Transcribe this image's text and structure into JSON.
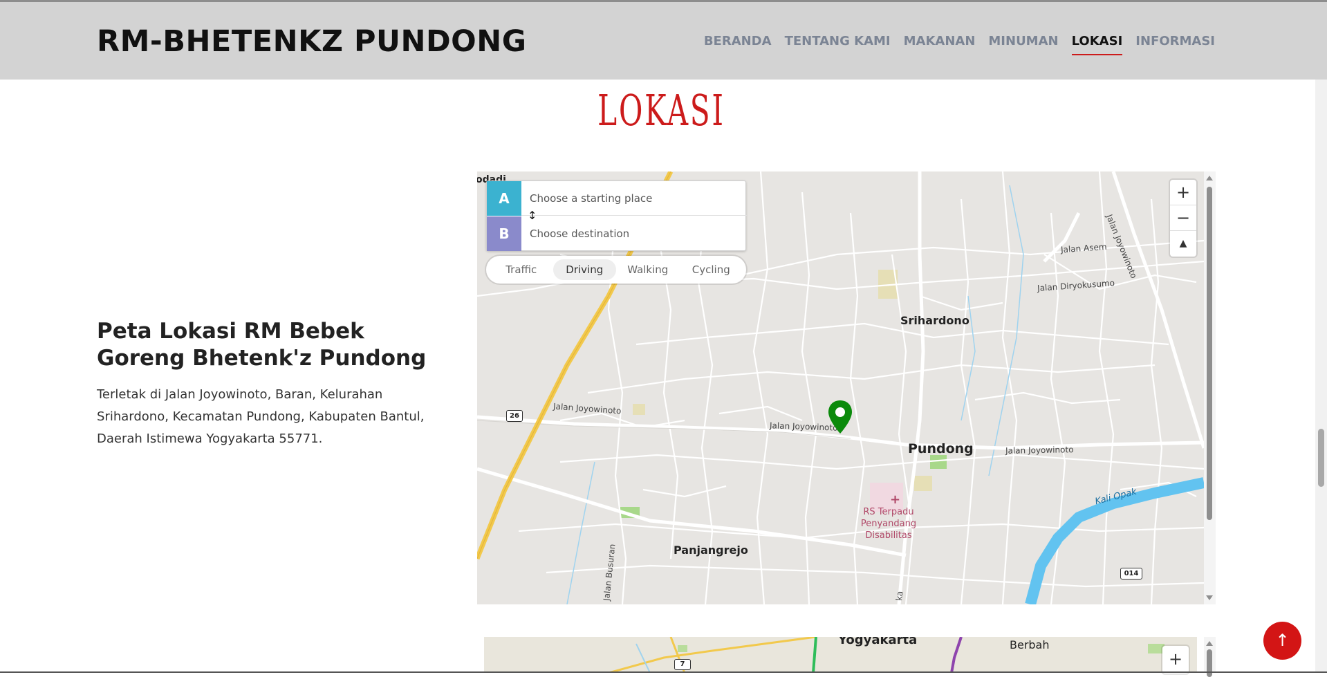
{
  "header": {
    "brand": "RM-BHETENKZ PUNDONG",
    "nav": [
      {
        "label": "BERANDA",
        "active": false
      },
      {
        "label": "TENTANG KAMI",
        "active": false
      },
      {
        "label": "MAKANAN",
        "active": false
      },
      {
        "label": "MINUMAN",
        "active": false
      },
      {
        "label": "LOKASI",
        "active": true
      },
      {
        "label": "INFORMASI",
        "active": false
      }
    ]
  },
  "section": {
    "title": "LOKASI"
  },
  "location": {
    "heading": "Peta Lokasi RM Bebek Goreng Bhetenk'z Pundong",
    "description": "Terletak di Jalan Joyowinoto, Baran, Kelurahan Srihardono, Kecamatan Pundong, Kabupaten Bantul, Daerah Istimewa Yogyakarta 55771."
  },
  "directions": {
    "a_label": "A",
    "b_label": "B",
    "start_placeholder": "Choose a starting place",
    "dest_placeholder": "Choose destination",
    "swap_icon": "↕",
    "modes": [
      "Traffic",
      "Driving",
      "Walking",
      "Cycling"
    ],
    "selected_mode": "Driving"
  },
  "map": {
    "zoom_in": "+",
    "zoom_out": "−",
    "compass": "▲",
    "labels": {
      "village1": "Srihardono",
      "village2": "Pundong",
      "village3": "Panjangrejo",
      "street1": "Jalan Joyowinoto",
      "street2": "Jalan Joyowinoto",
      "street3": "Jalan Joyowinoto",
      "street4": "Jalan Joyowinoto",
      "street5": "Jalan Asem",
      "street6": "Jalan Diryokusumo",
      "street7": "Jalan Busuran",
      "river": "Kali Opak",
      "hospital1": "RS Terpadu Penyandang",
      "hospital2": "Disabilitas",
      "road_shield1": "26",
      "road_shield2": "014",
      "edge1": "odadi",
      "edge2": "ka",
      "edge3": "an Busuran"
    },
    "colors": {
      "marker": "#0b8a0b",
      "river": "#62c3f0",
      "arterial": "#f2c94c",
      "hospital": "#b04868"
    }
  },
  "map2": {
    "city": "Yogyakarta",
    "town": "Berbah",
    "shield": "7",
    "zoom_in": "+"
  },
  "back_to_top": "↑"
}
